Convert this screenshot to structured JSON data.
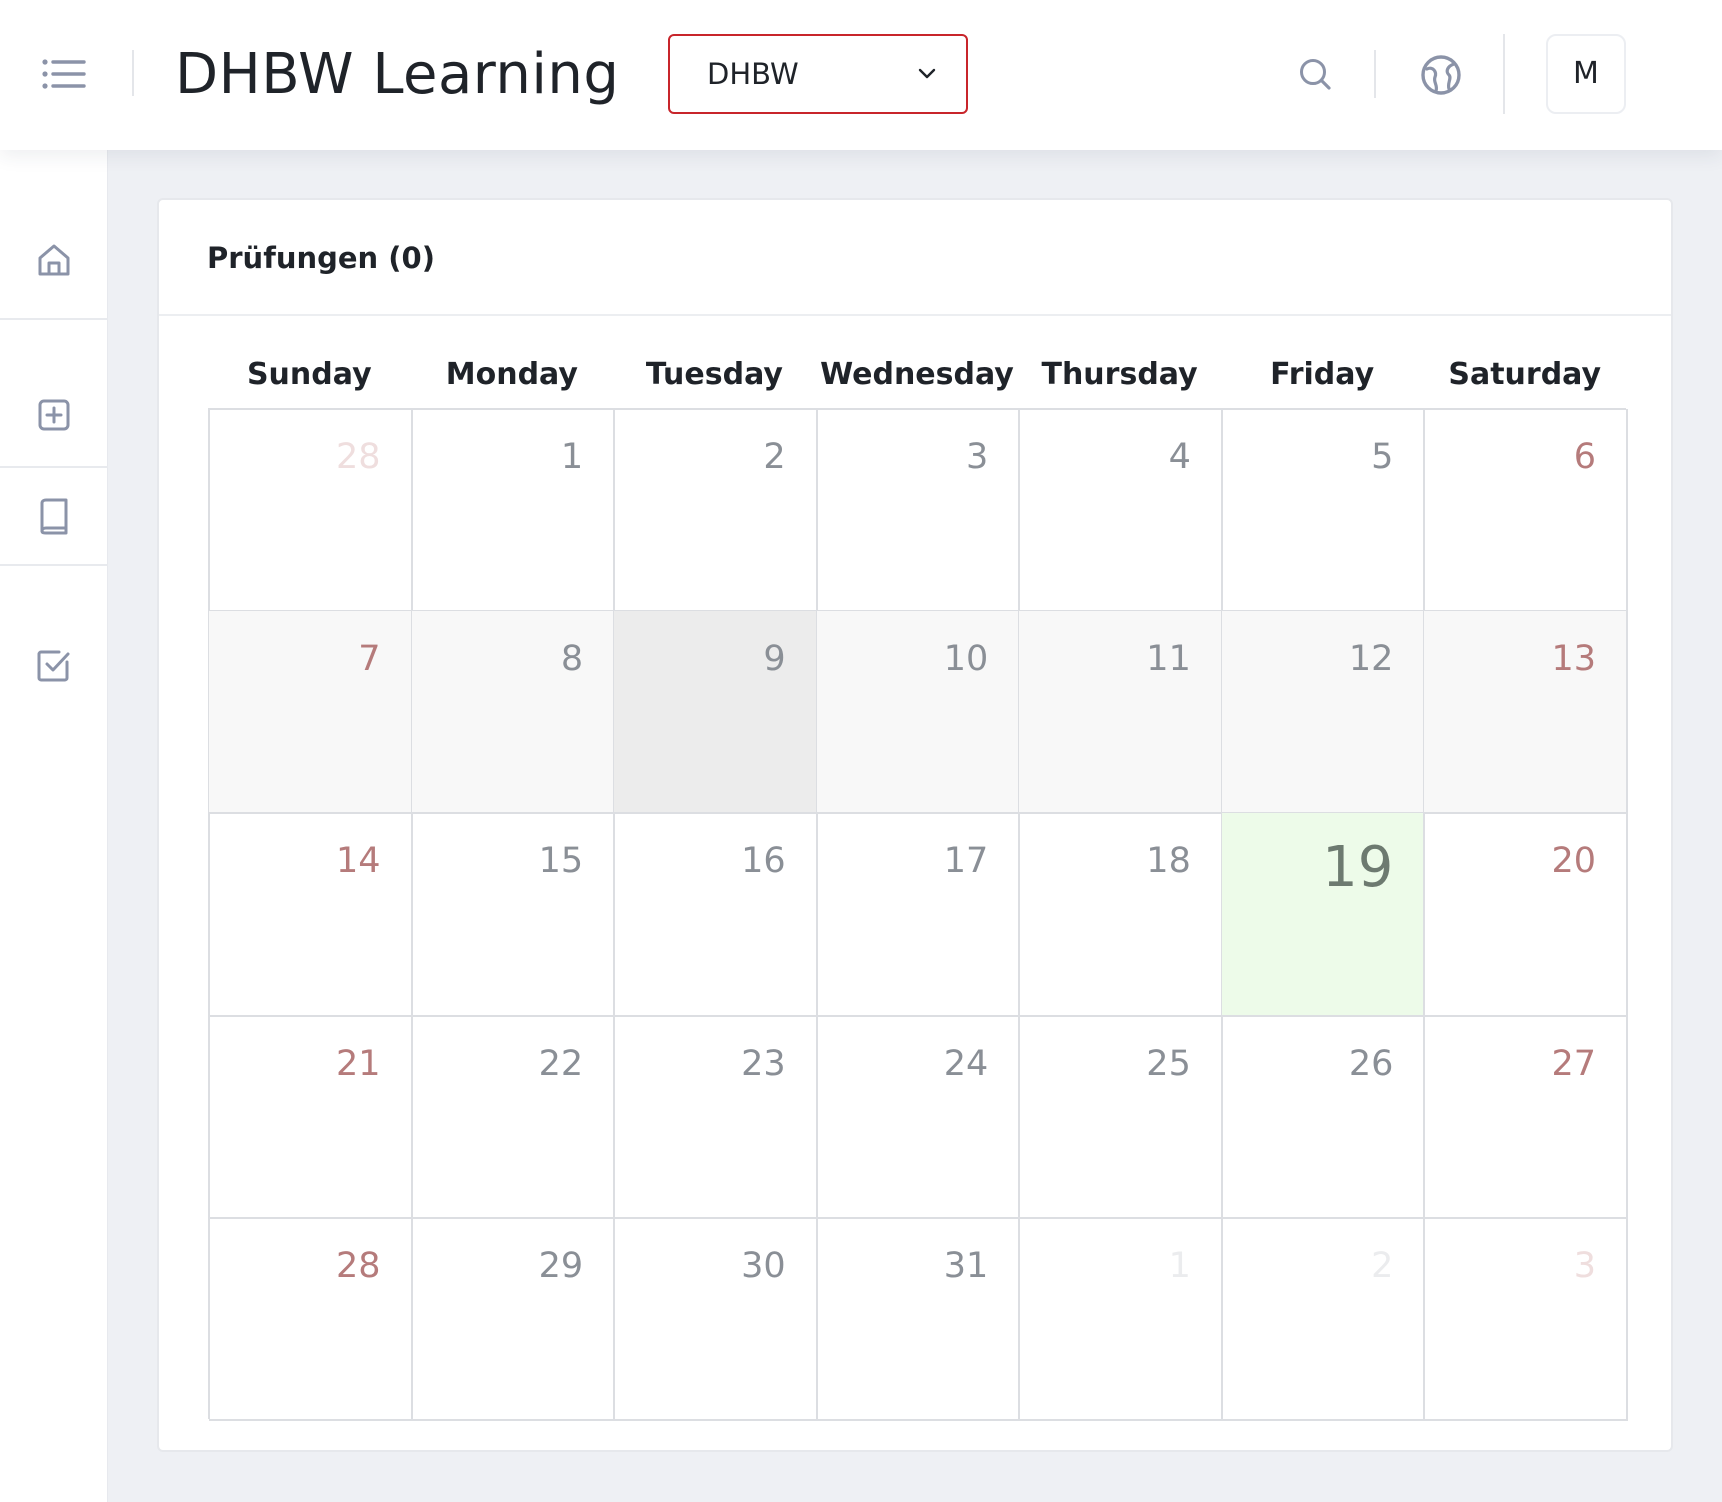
{
  "header": {
    "app_title": "DHBW Learning",
    "org_select": {
      "selected": "DHBW"
    },
    "avatar_initial": "M",
    "icons": [
      "menu-icon",
      "search-icon",
      "globe-icon"
    ]
  },
  "sidebar": {
    "items": [
      {
        "icon": "home-icon"
      },
      {
        "icon": "plus-square-icon"
      },
      {
        "icon": "book-icon"
      },
      {
        "icon": "checkbox-icon"
      }
    ]
  },
  "card": {
    "title": "Prüfungen (0)"
  },
  "calendar": {
    "weekdays": [
      "Sunday",
      "Monday",
      "Tuesday",
      "Wednesday",
      "Thursday",
      "Friday",
      "Saturday"
    ],
    "weeks": [
      [
        {
          "d": "28",
          "other": true
        },
        {
          "d": "1"
        },
        {
          "d": "2"
        },
        {
          "d": "3"
        },
        {
          "d": "4"
        },
        {
          "d": "5"
        },
        {
          "d": "6"
        }
      ],
      [
        {
          "d": "7"
        },
        {
          "d": "8"
        },
        {
          "d": "9"
        },
        {
          "d": "10"
        },
        {
          "d": "11"
        },
        {
          "d": "12"
        },
        {
          "d": "13"
        }
      ],
      [
        {
          "d": "14"
        },
        {
          "d": "15"
        },
        {
          "d": "16"
        },
        {
          "d": "17"
        },
        {
          "d": "18"
        },
        {
          "d": "19",
          "today": true
        },
        {
          "d": "20"
        }
      ],
      [
        {
          "d": "21"
        },
        {
          "d": "22"
        },
        {
          "d": "23"
        },
        {
          "d": "24"
        },
        {
          "d": "25"
        },
        {
          "d": "26"
        },
        {
          "d": "27"
        }
      ],
      [
        {
          "d": "28"
        },
        {
          "d": "29"
        },
        {
          "d": "30"
        },
        {
          "d": "31"
        },
        {
          "d": "1",
          "other": true
        },
        {
          "d": "2",
          "other": true
        },
        {
          "d": "3",
          "other": true
        }
      ]
    ],
    "colors": {
      "today_bg": "#edfbe9",
      "highlight_week_bg": "#f8f8f8",
      "hover_cell_bg": "#ececec",
      "weekend_number": "#b57b7b",
      "accent_border": "#c8252b"
    }
  }
}
